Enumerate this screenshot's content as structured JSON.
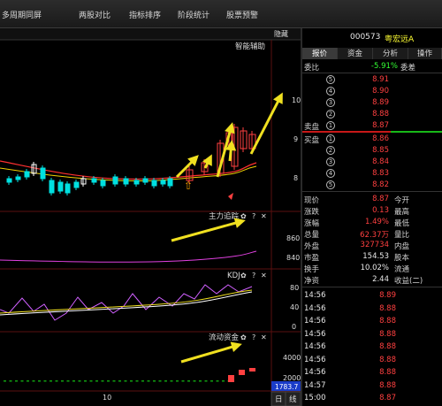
{
  "top_tabs": [
    "多周期同屏",
    "两股对比",
    "指标排序",
    "阶段统计",
    "股票预警"
  ],
  "collapse_label": "隐藏",
  "chart": {
    "main_title": "智能辅助",
    "main_axis": [
      "10",
      "9",
      "8"
    ],
    "ind1": {
      "title": "主力追踪",
      "axis": [
        "860",
        "840"
      ]
    },
    "ind2": {
      "title": "KDJ",
      "axis": [
        "80",
        "40",
        "0"
      ]
    },
    "ind3": {
      "title": "流动资金",
      "axis": [
        "4000",
        "2000"
      ],
      "badge": "1783.7"
    },
    "ctl_gear": "✿",
    "ctl_help": "?",
    "ctl_close": "✕",
    "x_label": "10",
    "bottom_tabs": [
      "日",
      "线"
    ],
    "up_arrow": "⇧"
  },
  "stock": {
    "code": "000573",
    "name": "粤宏远A"
  },
  "right_tabs": [
    "报价",
    "资金",
    "分析",
    "操作"
  ],
  "webi": {
    "label": "委比",
    "value": "-5.91%",
    "label2": "委差"
  },
  "sell": [
    {
      "n": "5",
      "price": "8.91"
    },
    {
      "n": "4",
      "price": "8.90"
    },
    {
      "n": "3",
      "price": "8.89"
    },
    {
      "n": "2",
      "price": "8.88"
    },
    {
      "n": "1",
      "price": "8.87",
      "label": "卖盘"
    }
  ],
  "buy": [
    {
      "n": "1",
      "price": "8.86",
      "label": "买盘"
    },
    {
      "n": "2",
      "price": "8.85"
    },
    {
      "n": "3",
      "price": "8.84"
    },
    {
      "n": "4",
      "price": "8.83"
    },
    {
      "n": "5",
      "price": "8.82"
    }
  ],
  "stats": [
    {
      "l1": "现价",
      "v1": "8.87",
      "l2": "今开"
    },
    {
      "l1": "涨跌",
      "v1": "0.13",
      "l2": "最高"
    },
    {
      "l1": "涨幅",
      "v1": "1.49%",
      "l2": "最低"
    },
    {
      "l1": "总量",
      "v1": "62.37万",
      "l2": "量比"
    },
    {
      "l1": "外盘",
      "v1": "327734",
      "l2": "内盘"
    },
    {
      "l1": "市盈",
      "v1": "154.53",
      "l2": "股本"
    },
    {
      "l1": "换手",
      "v1": "10.02%",
      "l2": "流通"
    },
    {
      "l1": "净资",
      "v1": "2.44",
      "l2": "收益(二)"
    }
  ],
  "ticks": [
    {
      "time": "14:56",
      "price": "8.89"
    },
    {
      "time": "14:56",
      "price": "8.88"
    },
    {
      "time": "14:56",
      "price": "8.88"
    },
    {
      "time": "14:56",
      "price": "8.88"
    },
    {
      "time": "14:56",
      "price": "8.88"
    },
    {
      "time": "14:56",
      "price": "8.88"
    },
    {
      "time": "14:56",
      "price": "8.88"
    },
    {
      "time": "14:57",
      "price": "8.88"
    },
    {
      "time": "15:00",
      "price": "8.87"
    }
  ],
  "colors": {
    "up": "#ff4040",
    "down": "#00e0e0",
    "arrow": "#f0e020",
    "accent": "#ffff33"
  }
}
